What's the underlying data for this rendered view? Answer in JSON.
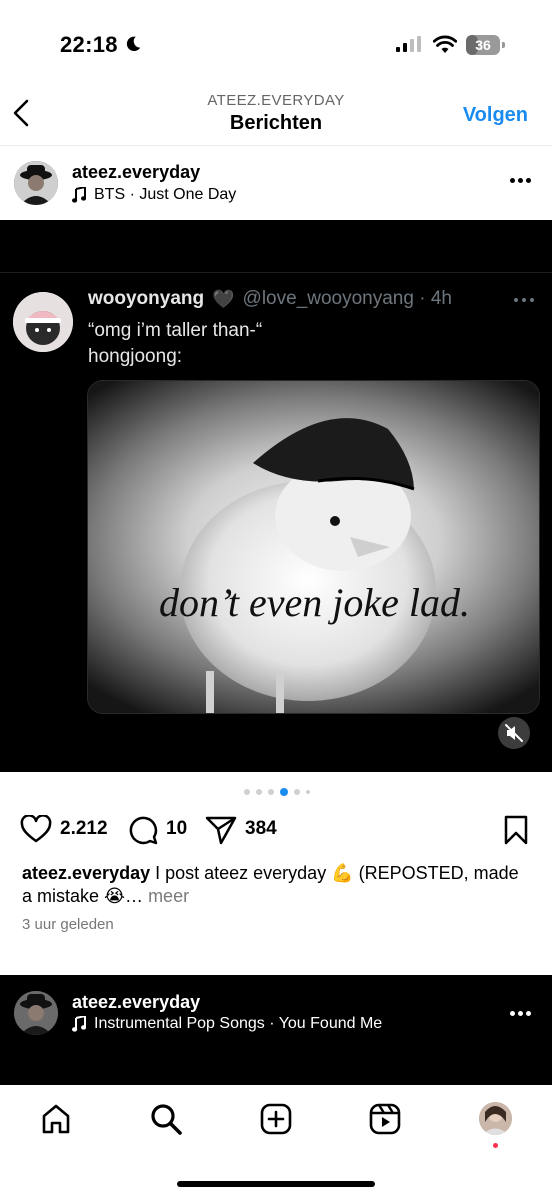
{
  "status_bar": {
    "time": "22:18",
    "battery_level": "36",
    "icons": [
      "moon-icon",
      "signal-icon",
      "wifi-icon",
      "battery-icon"
    ]
  },
  "nav": {
    "subtitle": "ATEEZ.EVERYDAY",
    "title": "Berichten",
    "follow_label": "Volgen"
  },
  "post": {
    "username": "ateez.everyday",
    "music": "BTS · Just One Day",
    "tweet": {
      "name": "wooyonyang",
      "heart": "🖤",
      "handle_time": "@love_wooyonyang · 4h",
      "line1": "“omg i’m taller than-“",
      "line2": "hongjoong:",
      "meme_caption": "don’t even joke lad."
    },
    "carousel": {
      "count": 6,
      "active_index": 3
    },
    "likes": "2.212",
    "comments": "10",
    "shares": "384",
    "caption_user": "ateez.everyday",
    "caption_text": " I post ateez everyday 💪 (REPOSTED, made a mistake 😭…",
    "caption_more": " meer",
    "timestamp": "3 uur geleden"
  },
  "next_post": {
    "username": "ateez.everyday",
    "music": "Instrumental Pop Songs · You Found Me"
  },
  "bottom_nav": {
    "items": [
      "home-icon",
      "search-icon",
      "create-icon",
      "reels-icon",
      "profile-avatar"
    ]
  },
  "colors": {
    "accent": "#1a8cf0",
    "muted": "#777777",
    "notification": "#ff2e4d"
  }
}
